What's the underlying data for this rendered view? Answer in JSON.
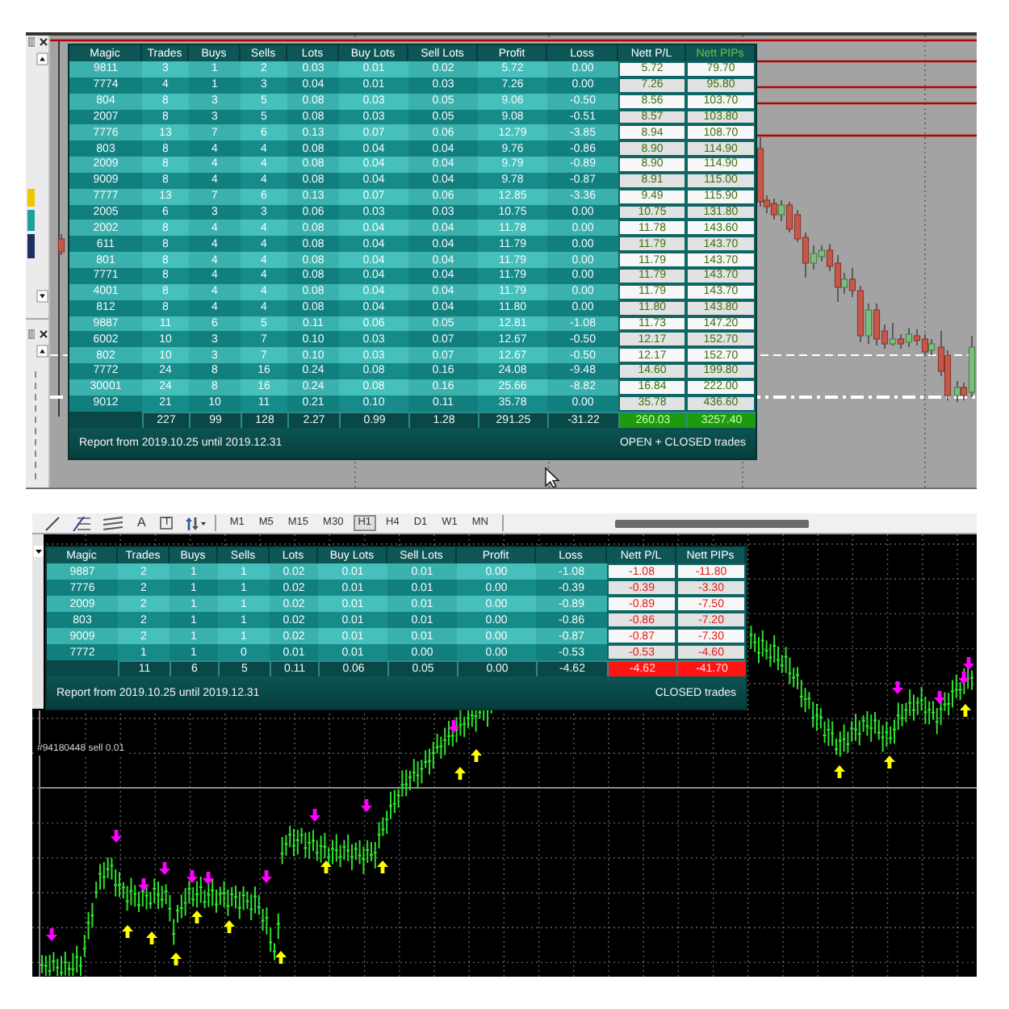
{
  "top_panel": {
    "report_table": {
      "columns": [
        {
          "label": "Magic",
          "highlighted": false
        },
        {
          "label": "Trades",
          "highlighted": false
        },
        {
          "label": "Buys",
          "highlighted": false
        },
        {
          "label": "Sells",
          "highlighted": false
        },
        {
          "label": "Lots",
          "highlighted": false
        },
        {
          "label": "Buy Lots",
          "highlighted": false
        },
        {
          "label": "Sell Lots",
          "highlighted": false
        },
        {
          "label": "Profit",
          "highlighted": false
        },
        {
          "label": "Loss",
          "highlighted": false
        },
        {
          "label": "Nett P/L",
          "highlighted": false
        },
        {
          "label": "Nett PIPs",
          "highlighted": true
        }
      ],
      "in_loss": false,
      "rows": [
        [
          "9811",
          "3",
          "1",
          "2",
          "0.03",
          "0.01",
          "0.02",
          "5.72",
          "0.00",
          "5.72",
          "79.70"
        ],
        [
          "7774",
          "4",
          "1",
          "3",
          "0.04",
          "0.01",
          "0.03",
          "7.26",
          "0.00",
          "7.26",
          "95.80"
        ],
        [
          "804",
          "8",
          "3",
          "5",
          "0.08",
          "0.03",
          "0.05",
          "9.06",
          "-0.50",
          "8.56",
          "103.70"
        ],
        [
          "2007",
          "8",
          "3",
          "5",
          "0.08",
          "0.03",
          "0.05",
          "9.08",
          "-0.51",
          "8.57",
          "103.80"
        ],
        [
          "7776",
          "13",
          "7",
          "6",
          "0.13",
          "0.07",
          "0.06",
          "12.79",
          "-3.85",
          "8.94",
          "108.70"
        ],
        [
          "803",
          "8",
          "4",
          "4",
          "0.08",
          "0.04",
          "0.04",
          "9.76",
          "-0.86",
          "8.90",
          "114.90"
        ],
        [
          "2009",
          "8",
          "4",
          "4",
          "0.08",
          "0.04",
          "0.04",
          "9.79",
          "-0.89",
          "8.90",
          "114.90"
        ],
        [
          "9009",
          "8",
          "4",
          "4",
          "0.08",
          "0.04",
          "0.04",
          "9.78",
          "-0.87",
          "8.91",
          "115.00"
        ],
        [
          "7777",
          "13",
          "7",
          "6",
          "0.13",
          "0.07",
          "0.06",
          "12.85",
          "-3.36",
          "9.49",
          "115.90"
        ],
        [
          "2005",
          "6",
          "3",
          "3",
          "0.06",
          "0.03",
          "0.03",
          "10.75",
          "0.00",
          "10.75",
          "131.80"
        ],
        [
          "2002",
          "8",
          "4",
          "4",
          "0.08",
          "0.04",
          "0.04",
          "11.78",
          "0.00",
          "11.78",
          "143.60"
        ],
        [
          "611",
          "8",
          "4",
          "4",
          "0.08",
          "0.04",
          "0.04",
          "11.79",
          "0.00",
          "11.79",
          "143.70"
        ],
        [
          "801",
          "8",
          "4",
          "4",
          "0.08",
          "0.04",
          "0.04",
          "11.79",
          "0.00",
          "11.79",
          "143.70"
        ],
        [
          "7771",
          "8",
          "4",
          "4",
          "0.08",
          "0.04",
          "0.04",
          "11.79",
          "0.00",
          "11.79",
          "143.70"
        ],
        [
          "4001",
          "8",
          "4",
          "4",
          "0.08",
          "0.04",
          "0.04",
          "11.79",
          "0.00",
          "11.79",
          "143.70"
        ],
        [
          "812",
          "8",
          "4",
          "4",
          "0.08",
          "0.04",
          "0.04",
          "11.80",
          "0.00",
          "11.80",
          "143.80"
        ],
        [
          "9887",
          "11",
          "6",
          "5",
          "0.11",
          "0.06",
          "0.05",
          "12.81",
          "-1.08",
          "11.73",
          "147.20"
        ],
        [
          "6002",
          "10",
          "3",
          "7",
          "0.10",
          "0.03",
          "0.07",
          "12.67",
          "-0.50",
          "12.17",
          "152.70"
        ],
        [
          "802",
          "10",
          "3",
          "7",
          "0.10",
          "0.03",
          "0.07",
          "12.67",
          "-0.50",
          "12.17",
          "152.70"
        ],
        [
          "7772",
          "24",
          "8",
          "16",
          "0.24",
          "0.08",
          "0.16",
          "24.08",
          "-9.48",
          "14.60",
          "199.80"
        ],
        [
          "30001",
          "24",
          "8",
          "16",
          "0.24",
          "0.08",
          "0.16",
          "25.66",
          "-8.82",
          "16.84",
          "222.00"
        ],
        [
          "9012",
          "21",
          "10",
          "11",
          "0.21",
          "0.10",
          "0.11",
          "35.78",
          "0.00",
          "35.78",
          "436.60"
        ]
      ],
      "totals": [
        "227",
        "99",
        "128",
        "2.27",
        "0.99",
        "1.28",
        "291.25",
        "-31.22",
        "260.03",
        "3257.40"
      ],
      "footer_left": "Report from 2019.10.25 until 2019.12.31",
      "footer_right": "OPEN + CLOSED trades"
    }
  },
  "bottom_panel": {
    "toolbar": {
      "tools": [
        {
          "kind": "line"
        },
        {
          "kind": "levels"
        },
        {
          "kind": "channel"
        },
        {
          "kind": "text",
          "glyph": "A"
        },
        {
          "kind": "label",
          "glyph": "T"
        },
        {
          "kind": "arrows"
        }
      ],
      "timeframes": [
        {
          "label": "M1",
          "selected": false
        },
        {
          "label": "M5",
          "selected": false
        },
        {
          "label": "M15",
          "selected": false
        },
        {
          "label": "M30",
          "selected": false
        },
        {
          "label": "H1",
          "selected": true
        },
        {
          "label": "H4",
          "selected": false
        },
        {
          "label": "D1",
          "selected": false
        },
        {
          "label": "W1",
          "selected": false
        },
        {
          "label": "MN",
          "selected": false
        }
      ]
    },
    "report_table": {
      "columns": [
        {
          "label": "Magic",
          "highlighted": false
        },
        {
          "label": "Trades",
          "highlighted": false
        },
        {
          "label": "Buys",
          "highlighted": false
        },
        {
          "label": "Sells",
          "highlighted": false
        },
        {
          "label": "Lots",
          "highlighted": false
        },
        {
          "label": "Buy Lots",
          "highlighted": false
        },
        {
          "label": "Sell Lots",
          "highlighted": false
        },
        {
          "label": "Profit",
          "highlighted": false
        },
        {
          "label": "Loss",
          "highlighted": false
        },
        {
          "label": "Nett P/L",
          "highlighted": false
        },
        {
          "label": "Nett PIPs",
          "highlighted": false
        }
      ],
      "in_loss": true,
      "rows": [
        [
          "9887",
          "2",
          "1",
          "1",
          "0.02",
          "0.01",
          "0.01",
          "0.00",
          "-1.08",
          "-1.08",
          "-11.80"
        ],
        [
          "7776",
          "2",
          "1",
          "1",
          "0.02",
          "0.01",
          "0.01",
          "0.00",
          "-0.39",
          "-0.39",
          "-3.30"
        ],
        [
          "2009",
          "2",
          "1",
          "1",
          "0.02",
          "0.01",
          "0.01",
          "0.00",
          "-0.89",
          "-0.89",
          "-7.50"
        ],
        [
          "803",
          "2",
          "1",
          "1",
          "0.02",
          "0.01",
          "0.01",
          "0.00",
          "-0.86",
          "-0.86",
          "-7.20"
        ],
        [
          "9009",
          "2",
          "1",
          "1",
          "0.02",
          "0.01",
          "0.01",
          "0.00",
          "-0.87",
          "-0.87",
          "-7.30"
        ],
        [
          "7772",
          "1",
          "1",
          "0",
          "0.01",
          "0.01",
          "0.00",
          "0.00",
          "-0.53",
          "-0.53",
          "-4.60"
        ]
      ],
      "totals": [
        "11",
        "6",
        "5",
        "0.11",
        "0.06",
        "0.05",
        "0.00",
        "-4.62",
        "-4.62",
        "-41.70"
      ],
      "footer_left": "Report from 2019.10.25 until 2019.12.31",
      "footer_right": "CLOSED trades"
    },
    "order_label": "#94180448 sell 0.01"
  }
}
